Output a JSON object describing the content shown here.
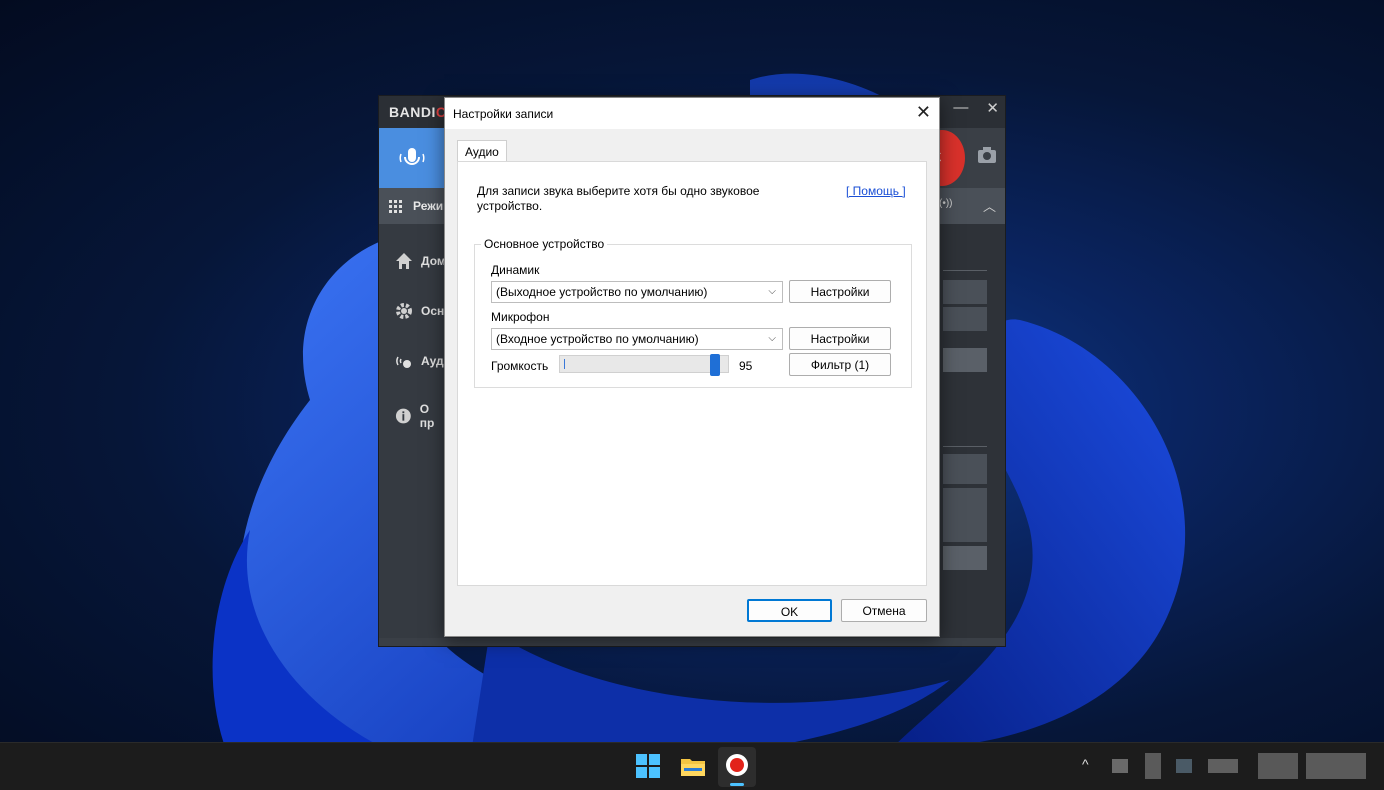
{
  "desktop": {
    "name": "Windows desktop"
  },
  "bandicam": {
    "logo_text": "BANDIC",
    "mode_label": "Режим",
    "rec_label": "C",
    "sidebar": [
      {
        "label": "Дом",
        "icon": "home-icon"
      },
      {
        "label": "Осн",
        "icon": "gear-icon"
      },
      {
        "label": "Ауди",
        "icon": "audio-settings-icon"
      },
      {
        "label": "О пр",
        "icon": "info-icon"
      }
    ],
    "menu_right": "(•))"
  },
  "dialog": {
    "title": "Настройки записи",
    "tab": "Аудио",
    "intro": "Для записи звука выберите хотя бы одно звуковое устройство.",
    "help_link": "[ Помощь ]",
    "group_label": "Основное устройство",
    "speaker_label": "Динамик",
    "speaker_value": "(Выходное устройство по умолчанию)",
    "speaker_settings": "Настройки",
    "mic_label": "Микрофон",
    "mic_value": "(Входное устройство по умолчанию)",
    "mic_settings": "Настройки",
    "volume_label": "Громкость",
    "volume_value": "95",
    "volume_fraction": 0.95,
    "filter_label": "Фильтр (1)",
    "ok_label": "OK",
    "cancel_label": "Отмена"
  },
  "taskbar": {
    "icons": [
      "windows-start-icon",
      "file-explorer-icon",
      "bandicam-icon"
    ],
    "tray_chevron": "^"
  },
  "colors": {
    "accent": "#0078d4",
    "bandicam_blue": "#4a8ee0",
    "rec_red": "#d9312b"
  }
}
